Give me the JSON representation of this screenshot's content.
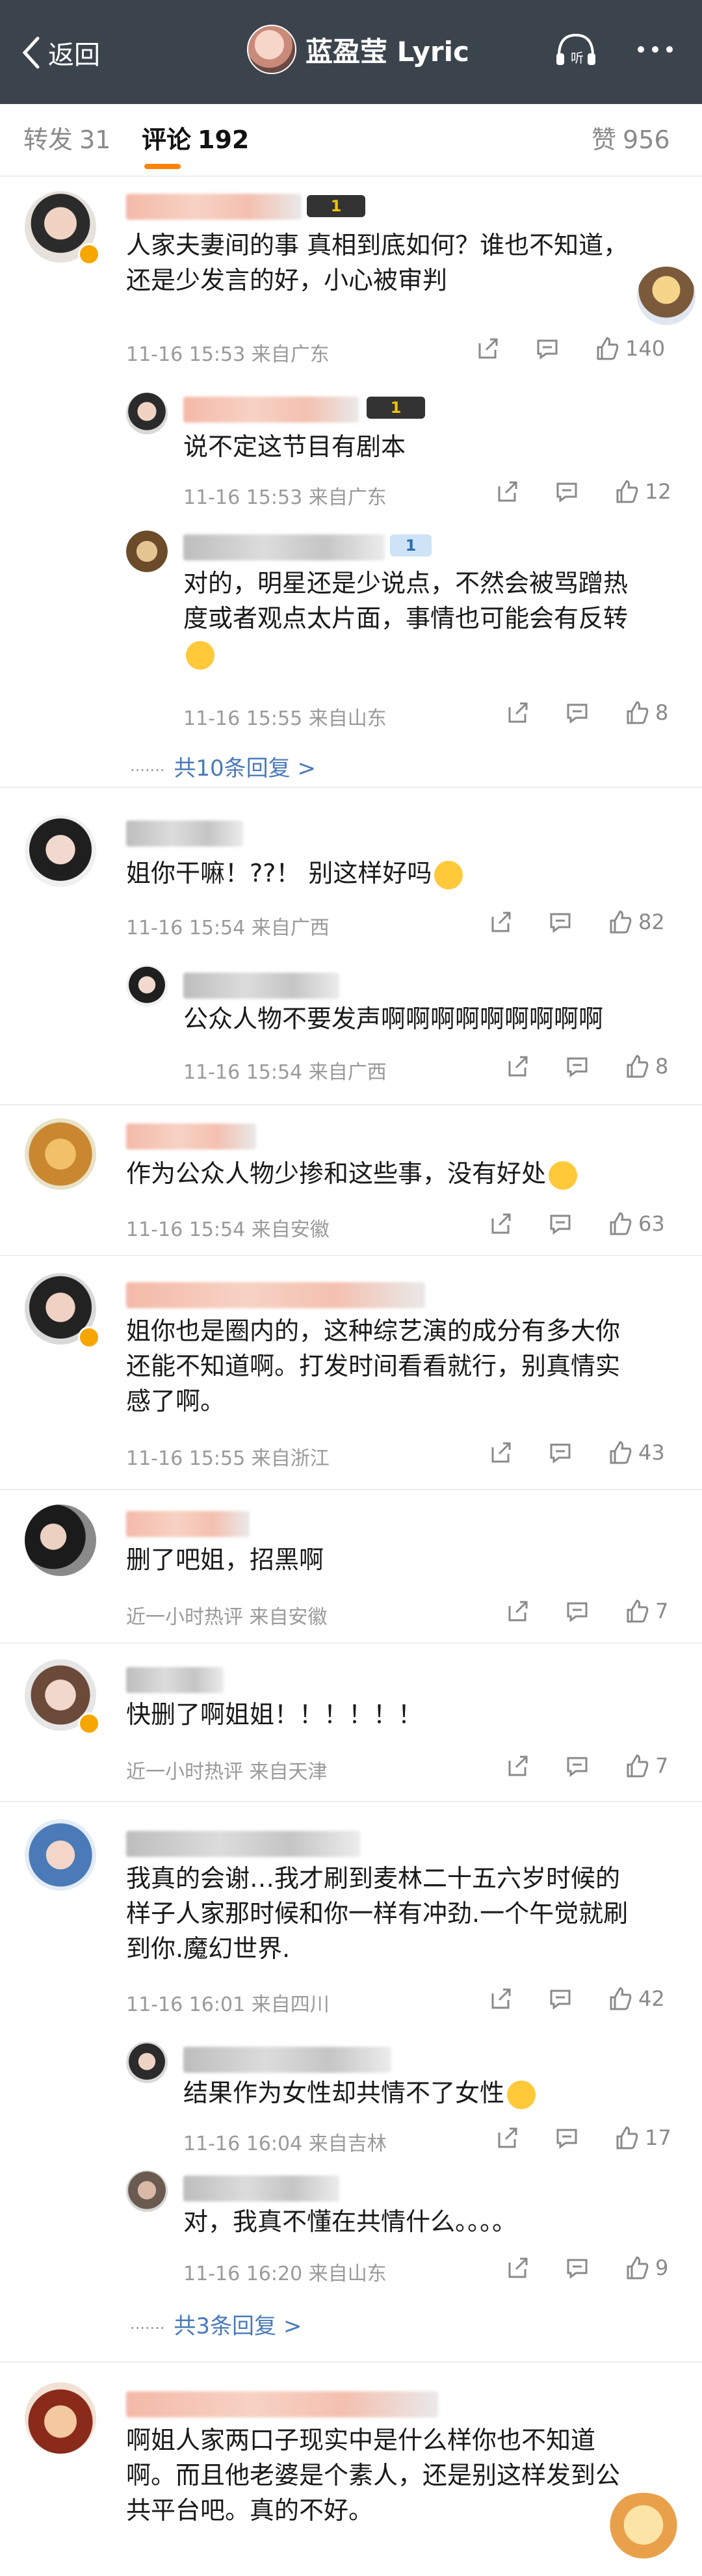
{
  "header": {
    "back_label": "返回",
    "title": "蓝盈莹 Lyric",
    "listen_label": "听"
  },
  "tabs": {
    "repost_label": "转发",
    "repost_count": "31",
    "comment_label": "评论",
    "comment_count": "192",
    "like_label": "赞",
    "like_count": "956"
  },
  "comments": [
    {
      "text_lines": [
        "人家夫妻间的事 真相到底如何？谁也不知道，",
        "还是少发言的好，小心被审判"
      ],
      "meta": "11-16 15:53  来自广东",
      "likes": "140",
      "replies": [
        {
          "text_lines": [
            "说不定这节目有剧本"
          ],
          "meta": "11-16 15:53  来自广东",
          "likes": "12"
        },
        {
          "text_lines": [
            "对的，明星还是少说点，不然会被骂蹭热",
            "度或者观点太片面，事情也可能会有反转"
          ],
          "meta": "11-16 15:55  来自山东",
          "likes": "8"
        }
      ],
      "more_replies": "共10条回复 >"
    },
    {
      "text_lines": [
        "姐你干嘛！??！ 别这样好吗"
      ],
      "meta": "11-16 15:54  来自广西",
      "likes": "82",
      "replies": [
        {
          "text_lines": [
            "公众人物不要发声啊啊啊啊啊啊啊啊啊"
          ],
          "meta": "11-16 15:54  来自广西",
          "likes": "8"
        }
      ]
    },
    {
      "text_lines": [
        "作为公众人物少掺和这些事，没有好处"
      ],
      "meta": "11-16 15:54  来自安徽",
      "likes": "63"
    },
    {
      "text_lines": [
        "姐你也是圈内的，这种综艺演的成分有多大你",
        "还能不知道啊。打发时间看看就行，别真情实",
        "感了啊。"
      ],
      "meta": "11-16 15:55  来自浙江",
      "likes": "43"
    },
    {
      "text_lines": [
        "删了吧姐，招黑啊"
      ],
      "meta": "近一小时热评  来自安徽",
      "likes": "7"
    },
    {
      "text_lines": [
        "快删了啊姐姐！！！！！！"
      ],
      "meta": "近一小时热评  来自天津",
      "likes": "7"
    },
    {
      "text_lines": [
        "我真的会谢…我才刷到麦林二十五六岁时候的",
        "样子人家那时候和你一样有冲劲.一个午觉就刷",
        "到你.魔幻世界."
      ],
      "meta": "11-16 16:01  来自四川",
      "likes": "42",
      "replies": [
        {
          "text_lines": [
            "结果作为女性却共情不了女性"
          ],
          "meta": "11-16 16:04  来自吉林",
          "likes": "17"
        },
        {
          "text_lines": [
            "对，我真不懂在共情什么。。。。"
          ],
          "meta": "11-16 16:20  来自山东",
          "likes": "9"
        }
      ],
      "more_replies": "共3条回复 >"
    },
    {
      "text_lines": [
        "啊姐人家两口子现实中是什么样你也不知道",
        "啊。而且他老婆是个素人，还是别这样发到公",
        "共平台吧。真的不好。"
      ]
    }
  ],
  "badges": {
    "level_1": "1"
  },
  "colors": {
    "header_bg": "#3b444d",
    "accent": "#ff8200",
    "link": "#4a7ab8"
  }
}
